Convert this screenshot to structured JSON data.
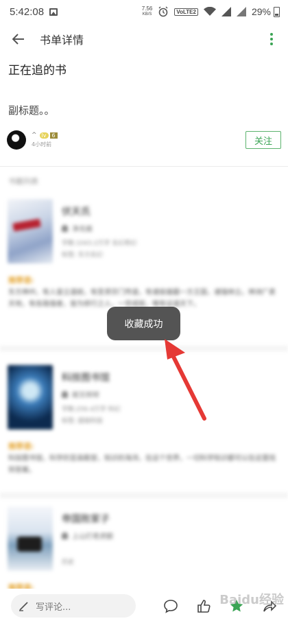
{
  "status_bar": {
    "time": "5:42:08",
    "speed_value": "7.56",
    "speed_unit": "KB/S",
    "volte": "VoLTE2",
    "battery": "29%"
  },
  "appbar": {
    "title": "书单详情"
  },
  "booklist": {
    "title": "正在追的书",
    "subtitle": "副标题。。",
    "author": {
      "name": "^",
      "level_badge": "lv",
      "level": "6",
      "time": "4小时前"
    },
    "follow_label": "关注"
  },
  "section_label": "书籍列表",
  "books": [
    {
      "name": "伏天氏",
      "author": "净无痕",
      "info": "字数:1043.2万字  玄幻奇幻",
      "tag": "标签: 东方玄幻",
      "rec_label": "推荐语:",
      "blurb": "东方神州，有人皇立道统，有圣贤宗门传道，有诸侯雄踞一方王国，诸强林立。神洲广袤天地，有各路强者，皆为修行之人，一世成就，唯有证道天下。"
    },
    {
      "name": "科技图书馆",
      "author": "姬叉样样",
      "info": "字数:256.4万字  科幻",
      "tag": "标签: 超级科技",
      "rec_label": "推荐语:",
      "blurb": "科技图书馆，科学的至高殿堂，知识的海洋。在这个世界，一切科学知识都可以在这里找到答案。"
    },
    {
      "name": "帝国败家子",
      "author": "上山打老虎额",
      "info": "",
      "tag": "历史",
      "rec_label": "推荐语:",
      "blurb": ""
    }
  ],
  "toast": {
    "text": "收藏成功"
  },
  "bottom_bar": {
    "comment_placeholder": "写评论..."
  },
  "watermark": "Baidu经验",
  "colors": {
    "accent": "#3aa454",
    "recommend": "#e4a430",
    "toast_bg": "#3c3c3c",
    "arrow": "#e53935"
  }
}
